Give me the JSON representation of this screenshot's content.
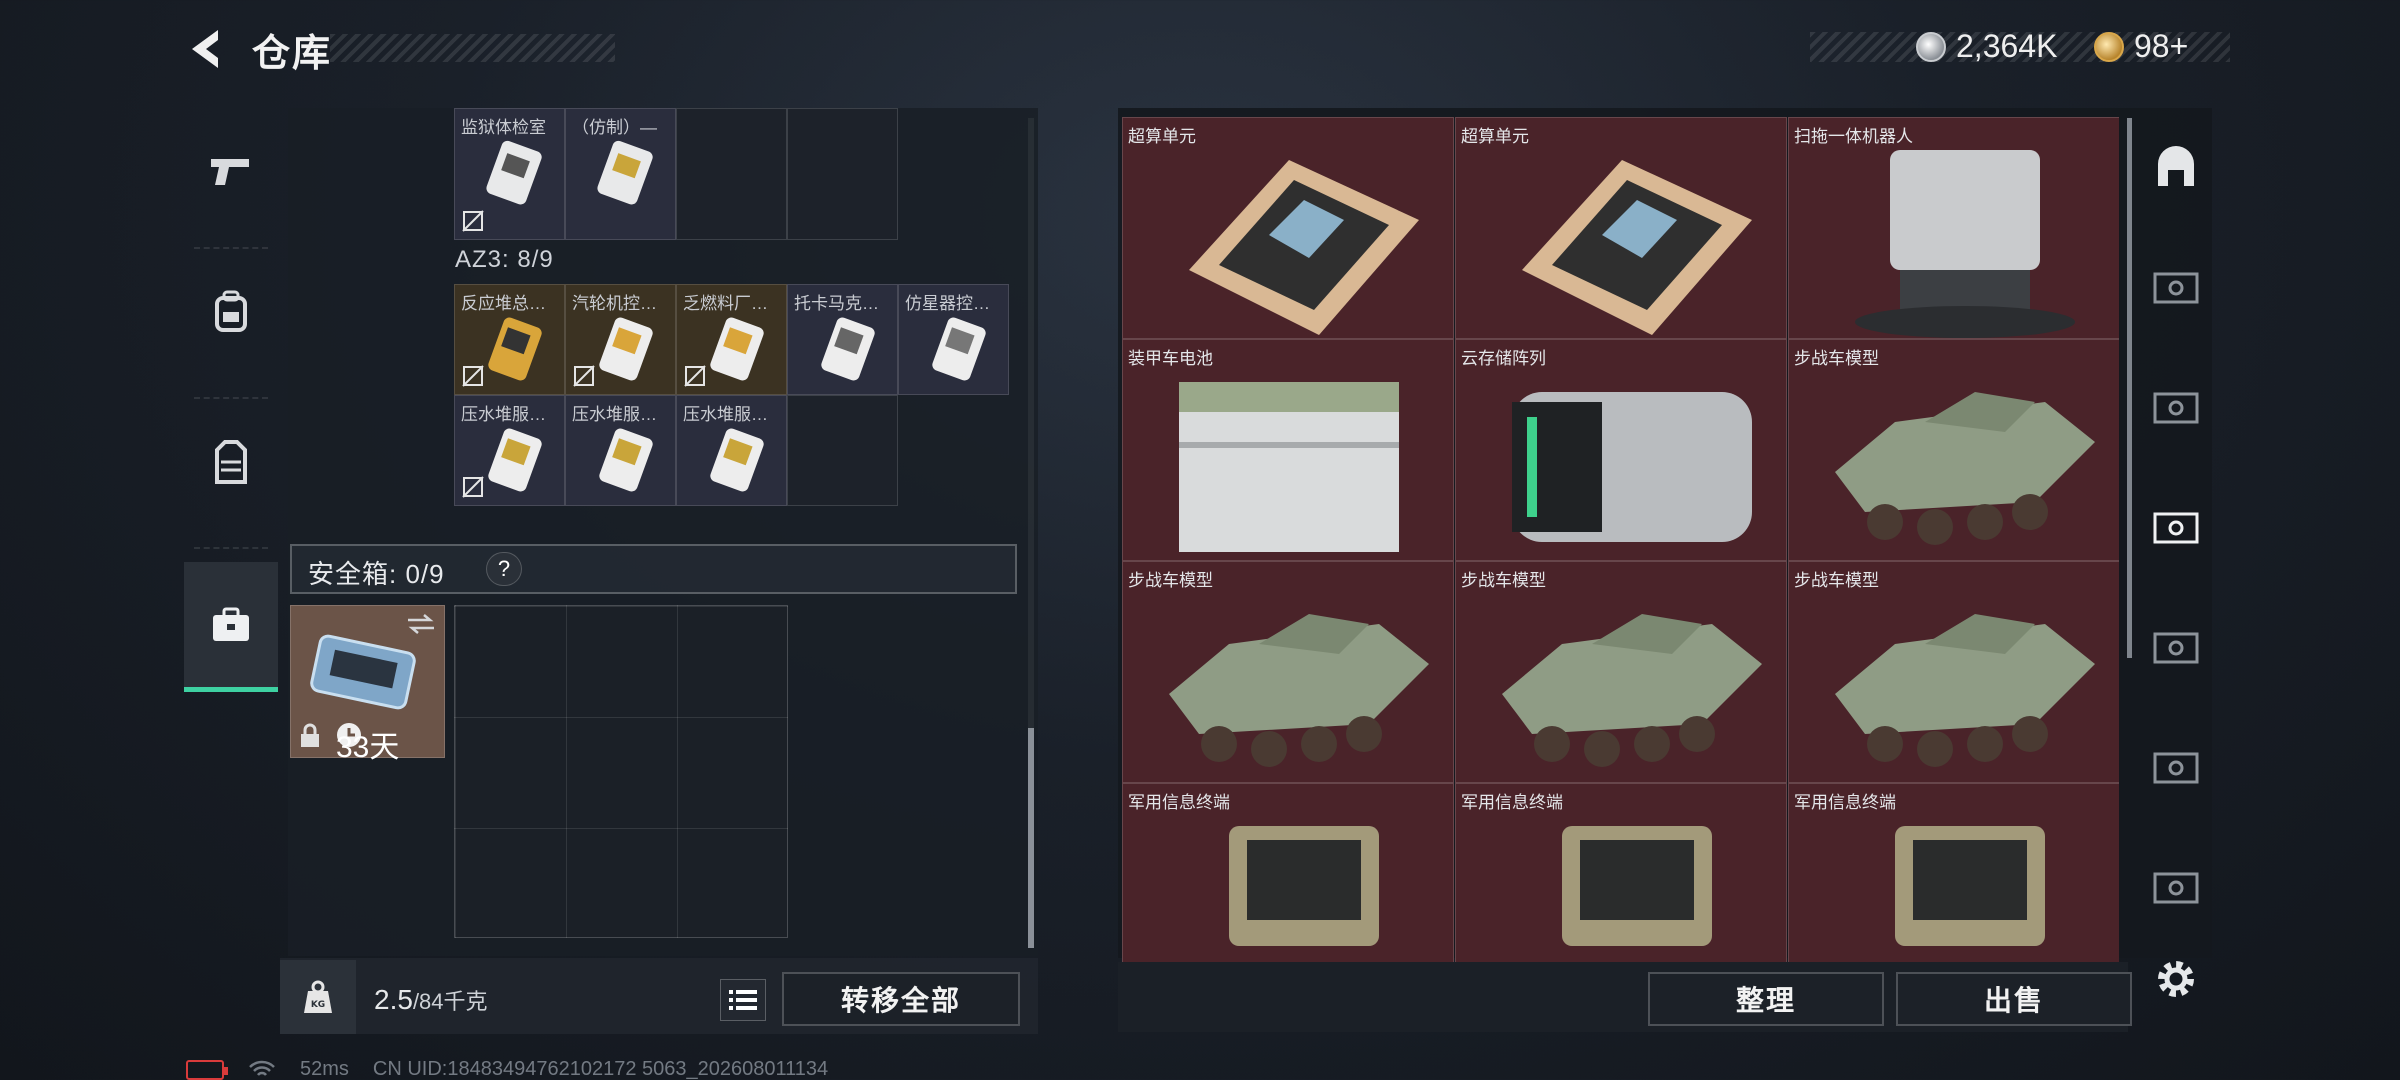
{
  "header": {
    "title": "仓库",
    "currencies": [
      {
        "icon": "silver-coin-icon",
        "value": "2,364K"
      },
      {
        "icon": "gold-coin-icon",
        "value": "98+"
      }
    ]
  },
  "categories": [
    {
      "icon": "pistol-icon",
      "active": false
    },
    {
      "icon": "backpack-icon",
      "active": false
    },
    {
      "icon": "vest-icon",
      "active": false
    },
    {
      "icon": "briefcase-icon",
      "active": true
    }
  ],
  "storage": {
    "top_items": [
      {
        "label": "监狱体检室",
        "rarity": "white"
      },
      {
        "label": "（仿制）—",
        "rarity": "white"
      }
    ],
    "section_label": "AZ3: 8/9",
    "items": [
      {
        "label": "反应堆总…",
        "rarity": "gold"
      },
      {
        "label": "汽轮机控…",
        "rarity": "gold"
      },
      {
        "label": "乏燃料厂…",
        "rarity": "gold"
      },
      {
        "label": "托卡马克…",
        "rarity": "white"
      },
      {
        "label": "仿星器控…",
        "rarity": "white"
      },
      {
        "label": "压水堆服…",
        "rarity": "white"
      },
      {
        "label": "压水堆服…",
        "rarity": "white"
      },
      {
        "label": "压水堆服…",
        "rarity": "white"
      }
    ]
  },
  "safe_box": {
    "label": "安全箱: 0/9",
    "help": "?",
    "expires": "33天"
  },
  "weight": {
    "current": "2.5",
    "max": "/84千克",
    "kg_icon": "KG"
  },
  "buttons": {
    "transfer_all": "转移全部",
    "organize": "整理",
    "sell": "出售"
  },
  "right_items": [
    {
      "label": "超算单元",
      "art": "board"
    },
    {
      "label": "超算单元",
      "art": "board"
    },
    {
      "label": "扫拖一体机器人",
      "art": "robot"
    },
    {
      "label": "装甲车电池",
      "art": "battery"
    },
    {
      "label": "云存储阵列",
      "art": "storage"
    },
    {
      "label": "步战车模型",
      "art": "ifv"
    },
    {
      "label": "步战车模型",
      "art": "ifv"
    },
    {
      "label": "步战车模型",
      "art": "ifv"
    },
    {
      "label": "步战车模型",
      "art": "ifv"
    },
    {
      "label": "军用信息终端",
      "art": "terminal"
    },
    {
      "label": "军用信息终端",
      "art": "terminal"
    },
    {
      "label": "军用信息终端",
      "art": "terminal"
    }
  ],
  "status": {
    "ping": "52ms",
    "uid": "CN UID:18483494762102172 5063_202608011134"
  }
}
